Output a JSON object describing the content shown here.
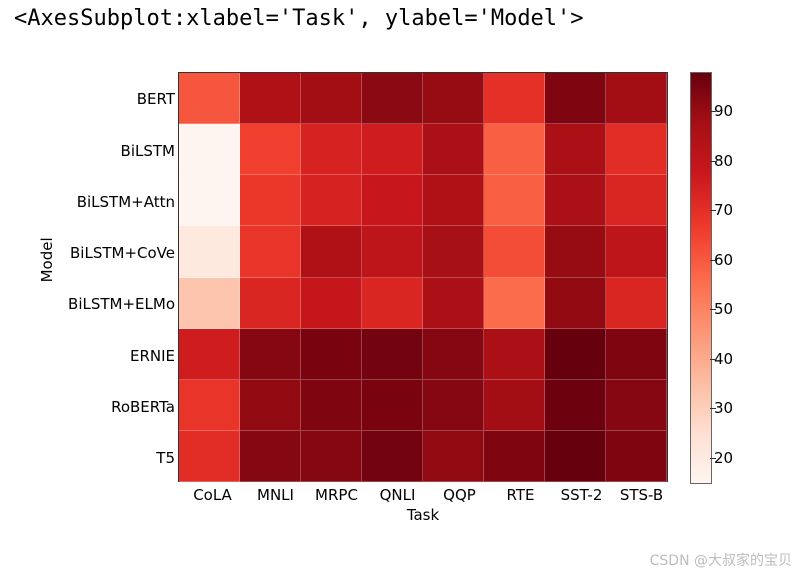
{
  "repr_text": "<AxesSubplot:xlabel='Task', ylabel='Model'>",
  "xlabel": "Task",
  "ylabel": "Model",
  "watermark": "CSDN @大叔家的宝贝",
  "chart_data": {
    "type": "heatmap",
    "xlabel": "Task",
    "ylabel": "Model",
    "x_categories": [
      "CoLA",
      "MNLI",
      "MRPC",
      "QNLI",
      "QQP",
      "RTE",
      "SST-2",
      "STS-B"
    ],
    "y_categories": [
      "BERT",
      "BiLSTM",
      "BiLSTM+Attn",
      "BiLSTM+CoVe",
      "BiLSTM+ELMo",
      "ERNIE",
      "RoBERTa",
      "T5"
    ],
    "colorbar_ticks": [
      20,
      30,
      40,
      50,
      60,
      70,
      80,
      90
    ],
    "value_range": [
      14,
      97
    ],
    "values": [
      [
        60,
        84,
        87,
        91,
        89,
        69,
        93,
        87
      ],
      [
        14,
        65,
        73,
        75,
        85,
        58,
        85,
        70
      ],
      [
        14,
        67,
        73,
        77,
        84,
        58,
        85,
        72
      ],
      [
        20,
        68,
        84,
        80,
        86,
        62,
        89,
        80
      ],
      [
        32,
        72,
        78,
        72,
        85,
        55,
        90,
        72
      ],
      [
        75,
        92,
        94,
        95,
        92,
        85,
        97,
        93
      ],
      [
        68,
        90,
        93,
        94,
        92,
        87,
        96,
        92
      ],
      [
        70,
        92,
        92,
        95,
        90,
        93,
        97,
        93
      ]
    ]
  }
}
